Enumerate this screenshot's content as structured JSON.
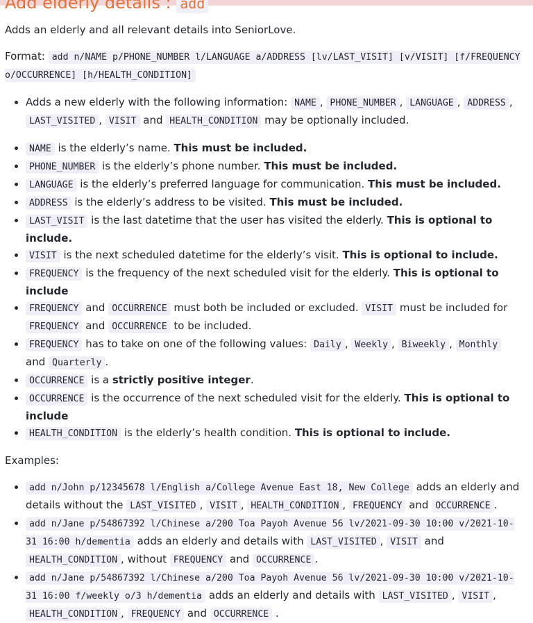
{
  "heading": {
    "text": "Add elderly details : ",
    "command": "add"
  },
  "intro": "Adds an elderly and all relevant details into SeniorLove.",
  "format": {
    "label": "Format: ",
    "command": "add n/NAME p/PHONE_NUMBER l/LANGUAGE a/ADDRESS [lv/LAST_VISIT] [v/VISIT] [f/FREQUENCY o/OCCURRENCE] [h/HEALTH_CONDITION]"
  },
  "info_item": {
    "text1": "Adds a new elderly with the following information: ",
    "c1": "NAME",
    "c2": "PHONE_NUMBER",
    "c3": "LANGUAGE",
    "c4": "ADDRESS",
    "c5": "LAST_VISITED",
    "c6": "VISIT",
    "c7": "HEALTH_CONDITION",
    "text2": " may be optionally included."
  },
  "fields": [
    {
      "code": "NAME",
      "text": " is the elderly’s name. ",
      "bold": "This must be included."
    },
    {
      "code": "PHONE_NUMBER",
      "text": " is the elderly’s phone number. ",
      "bold": "This must be included."
    },
    {
      "code": "LANGUAGE",
      "text": " is the elderly’s preferred language for communication. ",
      "bold": "This must be included."
    },
    {
      "code": "ADDRESS",
      "text": " is the elderly’s address to be visited. ",
      "bold": "This must be included."
    },
    {
      "code": "LAST_VISIT",
      "text": " is the last datetime that the user has visited the elderly. ",
      "bold": "This is optional to include."
    },
    {
      "code": "VISIT",
      "text": " is the next scheduled datetime for the elderly’s visit. ",
      "bold": "This is optional to include."
    },
    {
      "code": "FREQUENCY",
      "text": " is the frequency of the next scheduled visit for the elderly. ",
      "bold": "This is optional to include"
    }
  ],
  "rule_pair": {
    "c1": "FREQUENCY",
    "t1": " and ",
    "c2": "OCCURRENCE",
    "t2": " must both be included or excluded. ",
    "c3": "VISIT",
    "t3": " must be included for ",
    "c4": "FREQUENCY",
    "t4": " and ",
    "c5": "OCCURRENCE",
    "t5": " to be included."
  },
  "frequency_values": {
    "code": "FREQUENCY",
    "text": " has to take on one of the following values: ",
    "v1": "Daily",
    "v2": "Weekly",
    "v3": "Biweekly",
    "v4": "Monthly",
    "and": "and ",
    "v5": "Quarterly"
  },
  "occurrence_int": {
    "code": "OCCURRENCE",
    "text": " is a ",
    "bold": "strictly positive integer"
  },
  "occurrence_desc": {
    "code": "OCCURRENCE",
    "text": " is the occurrence of the next scheduled visit for the elderly. ",
    "bold": "This is optional to include"
  },
  "health": {
    "code": "HEALTH_CONDITION",
    "text": " is the elderly’s health condition. ",
    "bold": "This is optional to include."
  },
  "examples_label": "Examples:",
  "examples": [
    {
      "command": "add n/John p/12345678 l/English a/College Avenue East 18, New College",
      "t1": " adds an elderly and details without the ",
      "c1": "LAST_VISITED",
      "c2": "VISIT",
      "c3": "HEALTH_CONDITION",
      "c4": "FREQUENCY",
      "t2": " and ",
      "c5": "OCCURRENCE"
    },
    {
      "command": "add n/Jane p/54867392 l/Chinese a/200 Toa Payoh Avenue 56 lv/2021-09-30 10:00 v/2021-10-31 16:00 h/dementia",
      "t1": " adds an elderly and details with ",
      "c1": "LAST_VISITED",
      "c2": "VISIT",
      "t2": " and ",
      "c3": "HEALTH_CONDITION",
      "t3": ", without ",
      "c4": "FREQUENCY",
      "t4": " and ",
      "c5": "OCCURRENCE"
    },
    {
      "command": "add n/Jane p/54867392 l/Chinese a/200 Toa Payoh Avenue 56 lv/2021-09-30 10:00 v/2021-10-31 16:00 f/weekly o/3 h/dementia",
      "t1": " adds an elderly and details with ",
      "c1": "LAST_VISITED",
      "c2": "VISIT",
      "c3": "HEALTH_CONDITION",
      "c4": "FREQUENCY",
      "t2": " and ",
      "c5": "OCCURRENCE"
    }
  ]
}
